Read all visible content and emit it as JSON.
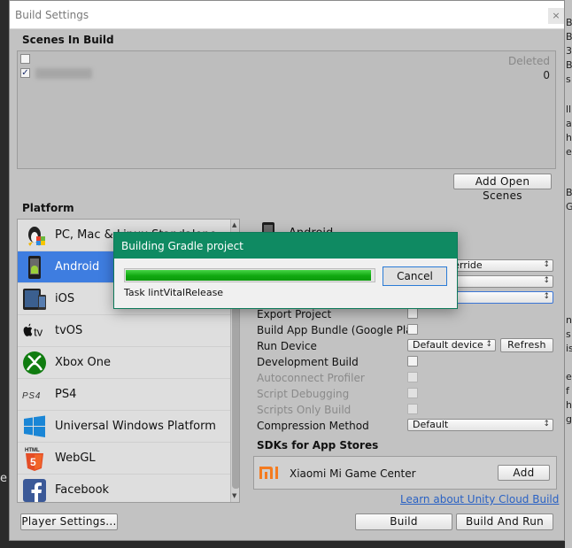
{
  "window": {
    "title": "Build Settings",
    "close_glyph": "×"
  },
  "scenes": {
    "header": "Scenes In Build",
    "deleted_label": "Deleted",
    "deleted_count": "0",
    "add_open_scenes": "Add Open Scenes"
  },
  "platform": {
    "header": "Platform",
    "items": [
      {
        "label": "PC, Mac & Linux Standalone",
        "icon": "pc-mac-linux-icon",
        "selected": false
      },
      {
        "label": "Android",
        "icon": "android-icon",
        "selected": true
      },
      {
        "label": "iOS",
        "icon": "ios-icon",
        "selected": false
      },
      {
        "label": "tvOS",
        "icon": "tvos-icon",
        "selected": false
      },
      {
        "label": "Xbox One",
        "icon": "xbox-icon",
        "selected": false
      },
      {
        "label": "PS4",
        "icon": "ps4-icon",
        "selected": false
      },
      {
        "label": "Universal Windows Platform",
        "icon": "windows-icon",
        "selected": false
      },
      {
        "label": "WebGL",
        "icon": "html5-icon",
        "selected": false
      },
      {
        "label": "Facebook",
        "icon": "facebook-icon",
        "selected": false
      }
    ]
  },
  "android_panel": {
    "title": "Android",
    "texture_compression_value": "Don't override",
    "options": {
      "export_project": "Export Project",
      "build_app_bundle": "Build App Bundle (Google Play)",
      "run_device": "Run Device",
      "run_device_value": "Default device",
      "refresh": "Refresh",
      "development_build": "Development Build",
      "autoconnect_profiler": "Autoconnect Profiler",
      "script_debugging": "Script Debugging",
      "scripts_only_build": "Scripts Only Build",
      "compression_method": "Compression Method",
      "compression_value": "Default"
    }
  },
  "sdks": {
    "header": "SDKs for App Stores",
    "store_name": "Xiaomi Mi Game Center",
    "add_label": "Add",
    "learn_link": "Learn about Unity Cloud Build"
  },
  "footer": {
    "player_settings": "Player Settings...",
    "build": "Build",
    "build_and_run": "Build And Run"
  },
  "progress_dialog": {
    "title": "Building Gradle project",
    "progress": 0.99,
    "cancel": "Cancel",
    "task": "Task lintVitalRelease"
  },
  "colors": {
    "selection_blue": "#3e7de0",
    "dialog_green": "#0f8a62",
    "progress_green": "#10a810",
    "link_blue": "#2a62c4",
    "xiaomi_orange": "#f47b20"
  }
}
